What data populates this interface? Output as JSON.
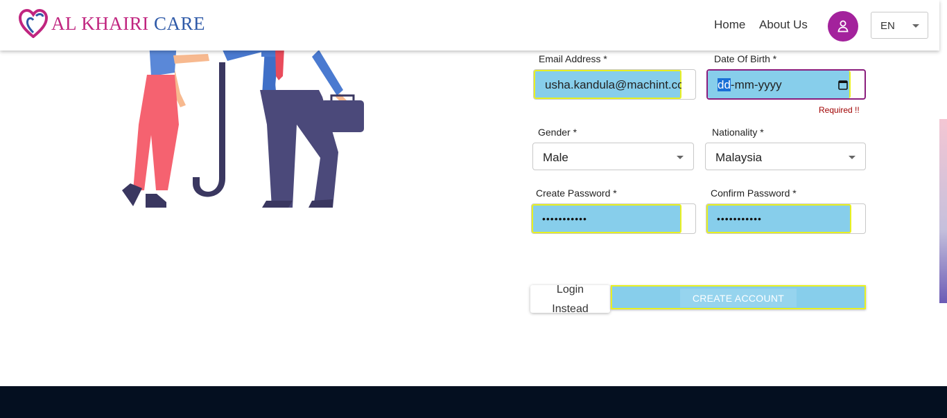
{
  "header": {
    "logo_part1": "AL KHAIRI",
    "logo_part2": "CARE",
    "nav": {
      "home": "Home",
      "about": "About Us"
    },
    "language": "EN"
  },
  "form": {
    "email": {
      "label": "Email Address *",
      "value": "usha.kandula@machint.co"
    },
    "dob": {
      "label": "Date Of Birth *",
      "value_highlight": "dd",
      "value_rest": "-mm-yyyy",
      "error": "Required !!"
    },
    "gender": {
      "label": "Gender *",
      "value": "Male"
    },
    "nationality": {
      "label": "Nationality *",
      "value": "Malaysia"
    },
    "password": {
      "label": "Create Password *",
      "value": "•••••••••••"
    },
    "confirm_password": {
      "label": "Confirm Password *",
      "value": "•••••••••••"
    },
    "login_button": "Login Instead",
    "create_button": "CREATE ACCOUNT"
  },
  "colors": {
    "brand_pink": "#c0257f",
    "brand_blue": "#2f5aa8",
    "avatar": "#a3229c",
    "autofill": "#87ceeb",
    "highlight_border": "#e8f020",
    "footer": "#040f20"
  }
}
